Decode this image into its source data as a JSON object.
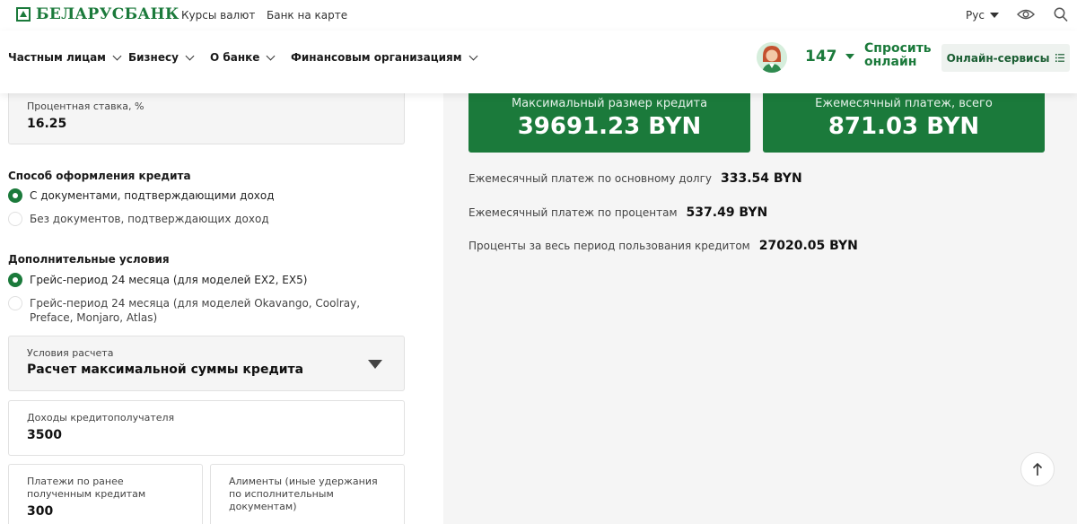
{
  "header": {
    "logo_text": "БЕЛАРУСБАНК",
    "links": [
      "Курсы валют",
      "Банк на карте"
    ],
    "language": "Рус"
  },
  "nav": {
    "items": [
      "Частным лицам",
      "Бизнесу",
      "О банке",
      "Финансовым организациям"
    ],
    "phone": "147",
    "ask_online": "Спросить онлайн",
    "online_services": "Онлайн-сервисы"
  },
  "form": {
    "rate": {
      "label": "Процентная ставка, %",
      "value": "16.25"
    },
    "method": {
      "title": "Способ оформления кредита",
      "options": [
        "С документами, подтверждающими доход",
        "Без документов, подтверждающих доход"
      ],
      "selected_index": 0
    },
    "extra": {
      "title": "Дополнительные условия",
      "options": [
        "Грейс-период 24 месяца (для моделей EX2, EX5)",
        "Грейс-период 24 месяца (для моделей Okavango, Coolray, Preface, Monjaro, Atlas)"
      ],
      "selected_index": 0
    },
    "calc_conditions": {
      "label": "Условия расчета",
      "value": "Расчет максимальной суммы кредита"
    },
    "income": {
      "label": "Доходы кредитополучателя",
      "value": "3500"
    },
    "prev_payments": {
      "label": "Платежи по ранее полученным кредитам",
      "value": "300"
    },
    "alimony": {
      "label": "Алименты (иные удержания по исполнительным документам)"
    }
  },
  "results": {
    "max_credit": {
      "label": "Максимальный размер кредита",
      "value": "39691.23 BYN"
    },
    "monthly_total": {
      "label": "Ежемесячный платеж, всего",
      "value": "871.03 BYN"
    },
    "rows": [
      {
        "label": "Ежемесячный платеж по основному долгу",
        "value": "333.54 BYN"
      },
      {
        "label": "Ежемесячный платеж по процентам",
        "value": "537.49 BYN"
      },
      {
        "label": "Проценты за весь период пользования кредитом",
        "value": "27020.05 BYN"
      }
    ]
  },
  "colors": {
    "brand_green": "#1b7a3b",
    "panel_grey": "#f5f5f5"
  },
  "icons": [
    "logo-icon",
    "eye-icon",
    "search-icon",
    "chevron-down-icon",
    "list-icon",
    "arrow-up-icon"
  ]
}
